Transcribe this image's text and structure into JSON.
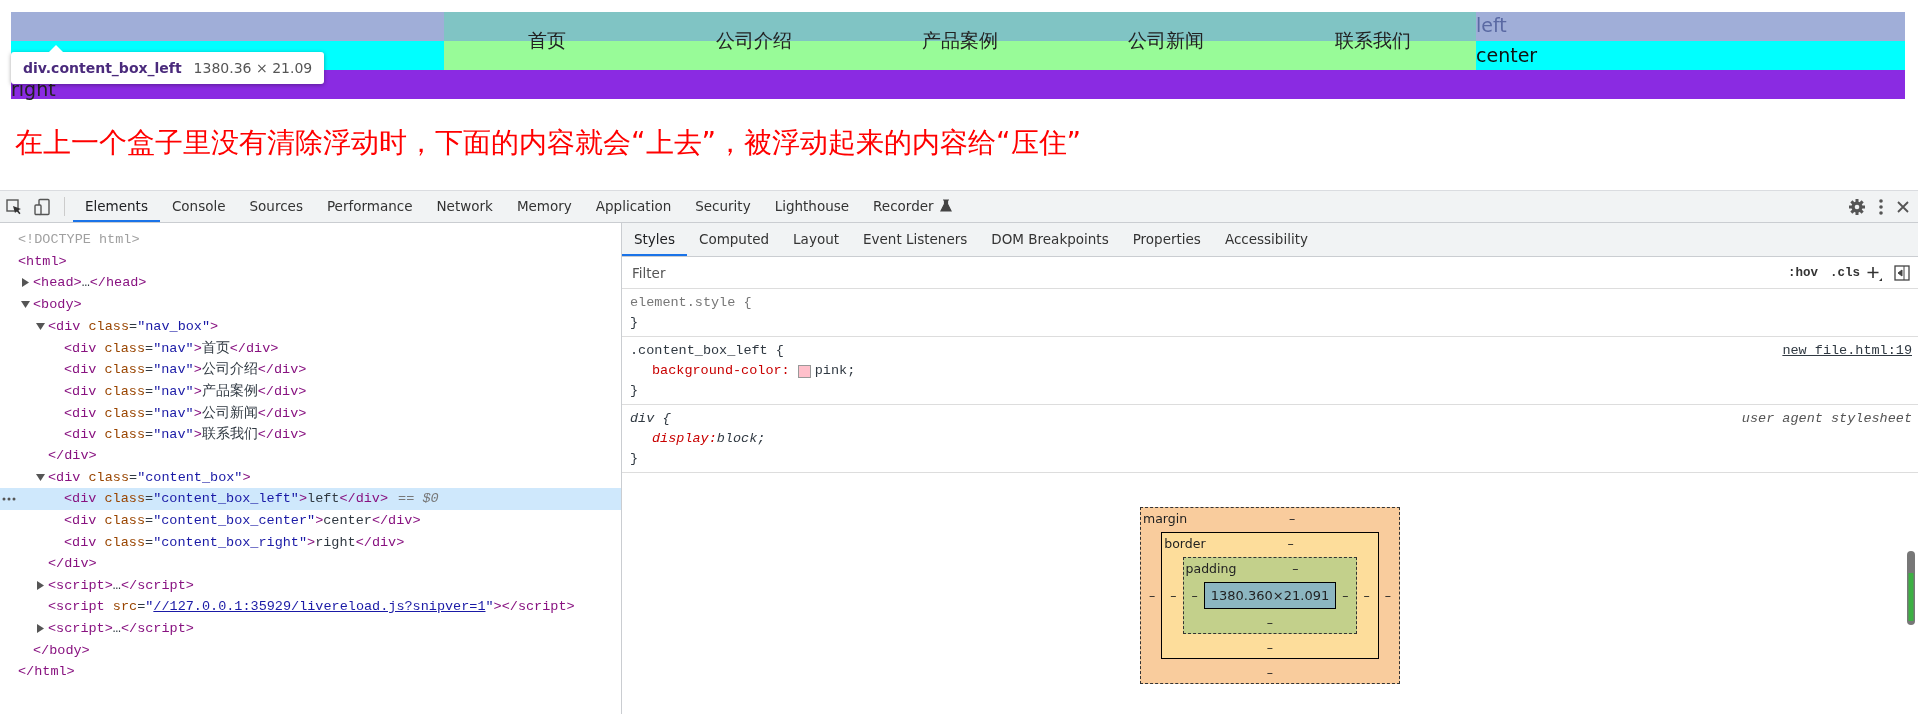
{
  "page": {
    "nav": [
      "首页",
      "公司介绍",
      "产品案例",
      "公司新闻",
      "联系我们"
    ],
    "boxes": {
      "left": "left",
      "center": "center",
      "right": "right"
    },
    "note": "在上一个盒子里没有清除浮动时，下面的内容就会“上去”，被浮动起来的内容给“压住”",
    "tooltip": {
      "selector": "div.content_box_left",
      "size": "1380.36 × 21.09"
    }
  },
  "devtools": {
    "tabs": [
      {
        "label": "Elements",
        "selected": true
      },
      {
        "label": "Console",
        "selected": false
      },
      {
        "label": "Sources",
        "selected": false
      },
      {
        "label": "Performance",
        "selected": false
      },
      {
        "label": "Network",
        "selected": false
      },
      {
        "label": "Memory",
        "selected": false
      },
      {
        "label": "Application",
        "selected": false
      },
      {
        "label": "Security",
        "selected": false
      },
      {
        "label": "Lighthouse",
        "selected": false
      },
      {
        "label": "Recorder",
        "selected": false,
        "kind": "experimental"
      }
    ],
    "tree": [
      {
        "text": "<!DOCTYPE html>",
        "kind": "doctype",
        "selected": false
      },
      {
        "text": "<html>",
        "close": "</html>",
        "selected": false,
        "children": [
          {
            "text": "<head>…</head>",
            "expanded": false,
            "selected": false
          },
          {
            "text": "<body>",
            "expanded": true,
            "close": "</body>",
            "selected": false,
            "children": [
              {
                "text": "<div class=\"nav_box\">",
                "expanded": true,
                "close": "</div>",
                "selected": false,
                "children": [
                  {
                    "text": "<div class=\"nav\">首页</div>",
                    "selected": false
                  },
                  {
                    "text": "<div class=\"nav\">公司介绍</div>",
                    "selected": false
                  },
                  {
                    "text": "<div class=\"nav\">产品案例</div>",
                    "selected": false
                  },
                  {
                    "text": "<div class=\"nav\">公司新闻</div>",
                    "selected": false
                  },
                  {
                    "text": "<div class=\"nav\">联系我们</div>",
                    "selected": false
                  }
                ]
              },
              {
                "text": "<div class=\"content_box\">",
                "expanded": true,
                "close": "</div>",
                "selected": false,
                "children": [
                  {
                    "text": "<div class=\"content_box_left\">left</div>",
                    "selected": true,
                    "badge": "== $0"
                  },
                  {
                    "text": "<div class=\"content_box_center\">center</div>",
                    "selected": false
                  },
                  {
                    "text": "<div class=\"content_box_right\">right</div>",
                    "selected": false
                  }
                ]
              },
              {
                "text": "<script>…</script>",
                "expanded": false,
                "selected": false
              },
              {
                "text": "<script src=\"",
                "link": "//127.0.0.1:35929/livereload.js?snipver=1",
                "after": "\"></script>",
                "selected": false
              },
              {
                "text": "<script>…</script>",
                "expanded": false,
                "selected": false
              }
            ]
          }
        ]
      }
    ],
    "subtabs": [
      {
        "label": "Styles",
        "selected": true
      },
      {
        "label": "Computed",
        "selected": false
      },
      {
        "label": "Layout",
        "selected": false
      },
      {
        "label": "Event Listeners",
        "selected": false
      },
      {
        "label": "DOM Breakpoints",
        "selected": false
      },
      {
        "label": "Properties",
        "selected": false
      },
      {
        "label": "Accessibility",
        "selected": false
      }
    ],
    "filter": {
      "placeholder": "Filter",
      "hov": ":hov",
      "cls": ".cls"
    },
    "rules": [
      {
        "kind": "inline",
        "selector": "element.style {",
        "close": "}"
      },
      {
        "kind": "author",
        "selector": ".content_box_left {",
        "source": "new_file.html:19",
        "close": "}",
        "declarations": [
          {
            "property": "background-color:",
            "value": "pink;",
            "kind": "color"
          }
        ]
      },
      {
        "kind": "user-agent",
        "selector": "div {",
        "source": "user agent stylesheet",
        "close": "}",
        "declarations": [
          {
            "property": "display:",
            "value": "block;"
          }
        ]
      }
    ],
    "box_model": {
      "margin": {
        "label": "margin",
        "top": "–",
        "right": "–",
        "bottom": "–",
        "left": "–"
      },
      "border": {
        "label": "border",
        "top": "–",
        "right": "–",
        "bottom": "–",
        "left": "–"
      },
      "padding": {
        "label": "padding",
        "top": "–",
        "right": "–",
        "bottom": "–",
        "left": "–"
      },
      "content": "1380.360×21.091"
    }
  }
}
